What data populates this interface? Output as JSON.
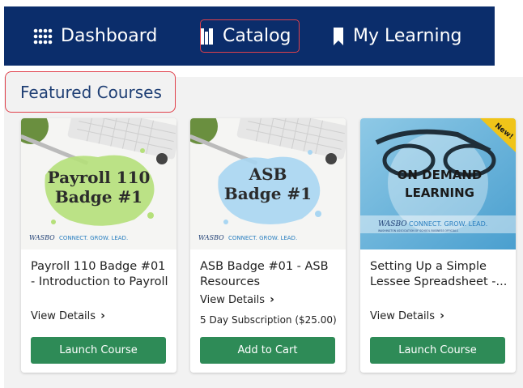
{
  "nav": {
    "items": [
      {
        "label": "Dashboard",
        "icon": "grid-icon"
      },
      {
        "label": "Catalog",
        "icon": "books-icon"
      },
      {
        "label": "My Learning",
        "icon": "bookmark-icon"
      }
    ]
  },
  "section": {
    "title": "Featured Courses"
  },
  "cards": [
    {
      "thumb_line1": "Payroll 110",
      "thumb_line2": "Badge #1",
      "thumb_brand": "WASBO",
      "thumb_tagline": "CONNECT. GROW. LEAD.",
      "title": "Payroll 110 Badge #01 - Introduction to Payroll",
      "details": "View Details",
      "button": "Launch Course"
    },
    {
      "thumb_line1": "ASB",
      "thumb_line2": "Badge #1",
      "thumb_brand": "WASBO",
      "thumb_tagline": "CONNECT. GROW. LEAD.",
      "title": "ASB Badge #01 - ASB Resources",
      "details": "View Details",
      "subscription": "5 Day Subscription ($25.00)",
      "button": "Add to Cart"
    },
    {
      "ribbon": "New!",
      "thumb_line1": "ON DEMAND",
      "thumb_line2": "LEARNING",
      "thumb_brand": "WASBO",
      "thumb_tagline": "CONNECT. GROW. LEAD.",
      "thumb_org": "WASHINGTON ASSOCIATION OF SCHOOL BUSINESS OFFICIALS",
      "title": "Setting Up a Simple Lessee Spreadsheet -...",
      "details": "View Details",
      "button": "Launch Course"
    }
  ],
  "colors": {
    "nav_bg": "#0b2d6b",
    "button": "#2e8b57",
    "highlight": "#e0404b",
    "title": "#1f3f74"
  }
}
